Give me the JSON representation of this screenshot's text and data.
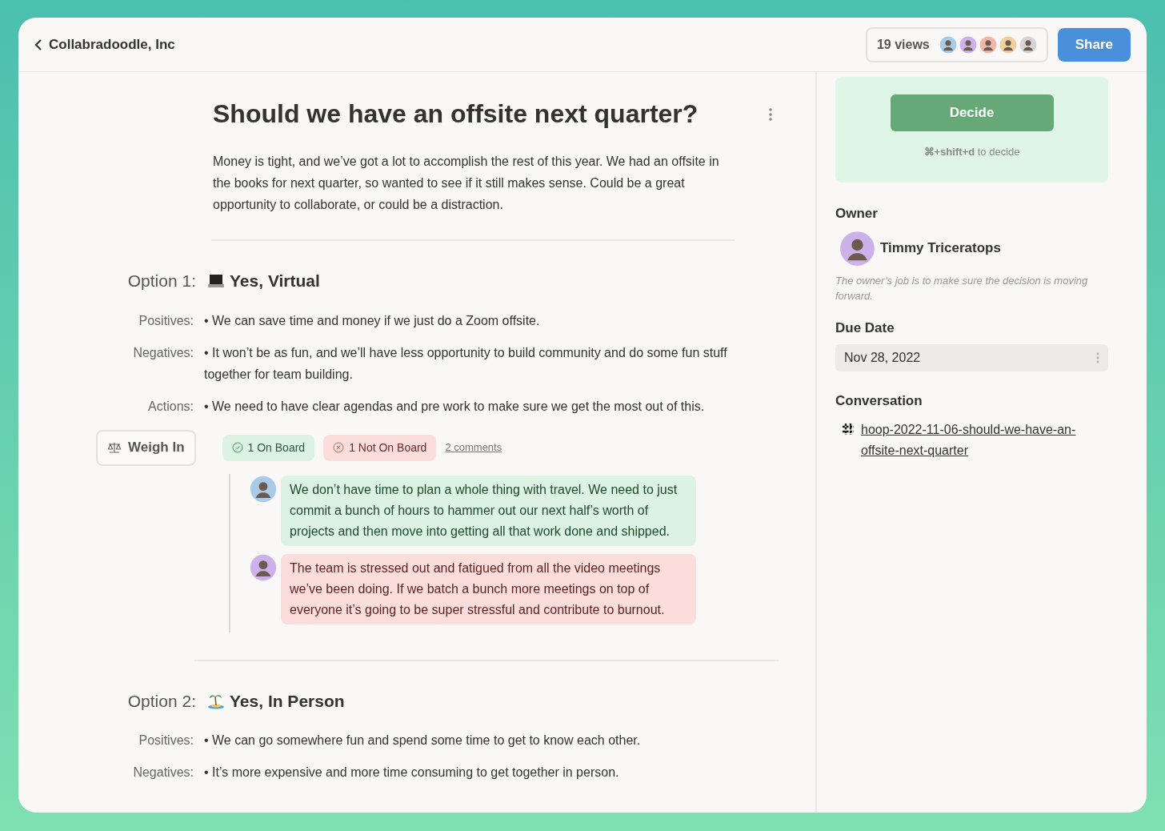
{
  "header": {
    "back_label": "Collabradoodle, Inc",
    "views": "19 views",
    "viewers": [
      {
        "color": "#a9cbe8"
      },
      {
        "color": "#cdb1ea"
      },
      {
        "color": "#f0b7a8"
      },
      {
        "color": "#f1cf9e"
      },
      {
        "color": "#d5d5d5"
      }
    ],
    "share": "Share"
  },
  "decision": {
    "title": "Should we have an offsite next quarter?",
    "description": "Money is tight, and we’ve got a lot to accomplish the rest of this year. We had an offsite in the books for next quarter, so wanted to see if it still makes sense. Could be a great opportunity to collaborate, or could be a distraction."
  },
  "options": [
    {
      "label": "Option 1:",
      "kind": "laptop",
      "name": "Yes, Virtual",
      "fields": [
        {
          "label": "Positives:",
          "text": "• We can save time and money if we just do a Zoom offsite."
        },
        {
          "label": "Negatives:",
          "text": "• It won’t be as fun, and we’ll have less opportunity to build community and do some fun stuff together for team building."
        },
        {
          "label": "Actions:",
          "text": "• We need to have clear agendas and pre work to make sure we get the most out of this."
        }
      ],
      "weigh_in": "Weigh In",
      "on_board": "1 On Board",
      "not_on_board": "1 Not On Board",
      "comments_link": "2 comments",
      "comments": [
        {
          "kind": "agree",
          "color": "#a9cbe8",
          "text": "We don’t have time to plan a whole thing with travel.  We need to just commit a bunch of hours to hammer out our next half’s worth of projects and then move into getting all that work done and shipped."
        },
        {
          "kind": "disagree",
          "color": "#cdb1ea",
          "text": "The team is stressed out and fatigued from all the video meetings we’ve been doing.  If we batch a bunch more meetings on top of everyone it’s going to be super stressful and contribute to burnout."
        }
      ]
    },
    {
      "label": "Option 2:",
      "kind": "island",
      "name": "Yes, In Person",
      "fields": [
        {
          "label": "Positives:",
          "text": "• We can go somewhere fun and spend some time to get to know each other."
        },
        {
          "label": "Negatives:",
          "text": "• It’s more expensive and more time consuming to get together in person."
        }
      ]
    }
  ],
  "sidebar": {
    "decide": "Decide",
    "shortcut_keys": "⌘+shift+d",
    "shortcut_text": "to decide",
    "owner_heading": "Owner",
    "owner": {
      "name": "Timmy Triceratops",
      "color": "#cdb1ea"
    },
    "owner_note": "The owner’s job is to make sure the decision is moving forward.",
    "due_heading": "Due Date",
    "due_date": "Nov 28, 2022",
    "conversation_heading": "Conversation",
    "channel": "hoop-2022-11-06-should-we-have-an-offsite-next-quarter"
  }
}
